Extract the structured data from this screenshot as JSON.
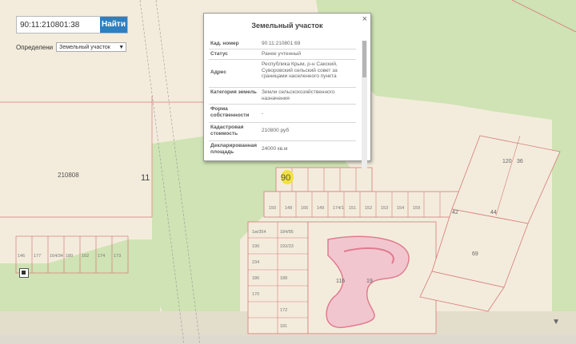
{
  "search": {
    "value": "90:11:210801:38",
    "button_label": "Найти"
  },
  "define": {
    "label": "Определени",
    "selected": "Земельный участок"
  },
  "popup": {
    "title": "Земельный участок",
    "close_icon": "close-icon",
    "rows": [
      {
        "key": "Кад. номер",
        "value": "90:11:210801:69"
      },
      {
        "key": "Статус",
        "value": "Ранее учтенный"
      },
      {
        "key": "Адрес",
        "value": "Республика Крым, р-н Сакский, Суворовский сельский совет за границами населенного пункта"
      },
      {
        "key": "Категория земель",
        "value": "Земли сельскохозяйственного назначения"
      },
      {
        "key": "Форма собственности",
        "value": "-"
      },
      {
        "key": "Кадастровая стоимость",
        "value": "210800 руб"
      },
      {
        "key": "Декларированная площадь",
        "value": "24000 кв.м"
      }
    ]
  },
  "map_labels": {
    "block": "210808",
    "quarter": "11",
    "marker": "90",
    "big": [
      "116",
      "120",
      "36",
      "44",
      "69",
      "19",
      "42"
    ],
    "parcels": [
      "146",
      "177",
      "164/34",
      "180",
      "162",
      "174",
      "173",
      "1м/354",
      "184/85",
      "190",
      "192/23",
      "234",
      "186",
      "188",
      "170",
      "172",
      "181",
      "150",
      "148",
      "166",
      "149",
      "174/1",
      "151",
      "152",
      "153",
      "154",
      "159"
    ]
  },
  "colors": {
    "green": "#cfe3b4",
    "beige": "#f3ecdc",
    "parcel_line": "#e0737a",
    "marker": "#f2e23c",
    "button": "#2f7fc0"
  }
}
